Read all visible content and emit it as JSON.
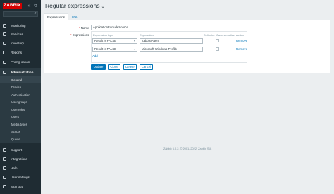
{
  "sidebar": {
    "logo": "ZABBIX",
    "collapse_icon": "«",
    "popout_icon": "⧉",
    "search_icon": "⌕",
    "nav": [
      {
        "label": "Monitoring",
        "icon": "monitoring-icon"
      },
      {
        "label": "Services",
        "icon": "services-icon"
      },
      {
        "label": "Inventory",
        "icon": "inventory-icon"
      },
      {
        "label": "Reports",
        "icon": "reports-icon"
      },
      {
        "label": "Configuration",
        "icon": "configuration-icon"
      },
      {
        "label": "Administration",
        "icon": "administration-icon"
      }
    ],
    "submenu": [
      {
        "label": "General"
      },
      {
        "label": "Proxies"
      },
      {
        "label": "Authentication"
      },
      {
        "label": "User groups"
      },
      {
        "label": "User roles"
      },
      {
        "label": "Users"
      },
      {
        "label": "Media types"
      },
      {
        "label": "Scripts"
      },
      {
        "label": "Queue"
      }
    ],
    "bottom": [
      {
        "label": "Support",
        "icon": "support-icon"
      },
      {
        "label": "Integrations",
        "icon": "integrations-icon"
      },
      {
        "label": "Help",
        "icon": "help-icon"
      },
      {
        "label": "User settings",
        "icon": "user-settings-icon"
      },
      {
        "label": "Sign out",
        "icon": "sign-out-icon"
      }
    ]
  },
  "header": {
    "title": "Regular expressions",
    "chevron": "⌄"
  },
  "tabs": [
    {
      "label": "Expressions"
    },
    {
      "label": "Test"
    }
  ],
  "form": {
    "name_label": "Name",
    "name_value": "ApplicationExcludeSource",
    "expressions_label": "Expressions",
    "columns": {
      "type": "Expression type",
      "expression": "Expression",
      "delimiter": "Delimiter",
      "case": "Case sensitive",
      "action": "Action"
    },
    "rows": [
      {
        "type": "Result is FALSE",
        "expression": "Zabbix Agent",
        "action": "Remove"
      },
      {
        "type": "Result is FALSE",
        "expression": "Microsoft-Windows-Perflib",
        "action": "Remove"
      }
    ],
    "add_label": "Add"
  },
  "buttons": {
    "update": "Update",
    "clone": "Clone",
    "delete": "Delete",
    "cancel": "Cancel"
  },
  "footer": "Zabbix 6.0.2. © 2001–2022, Zabbix SIA",
  "colors": {
    "sidebar": "#1f2c33",
    "accent": "#0275b8",
    "logo": "#d40000"
  }
}
